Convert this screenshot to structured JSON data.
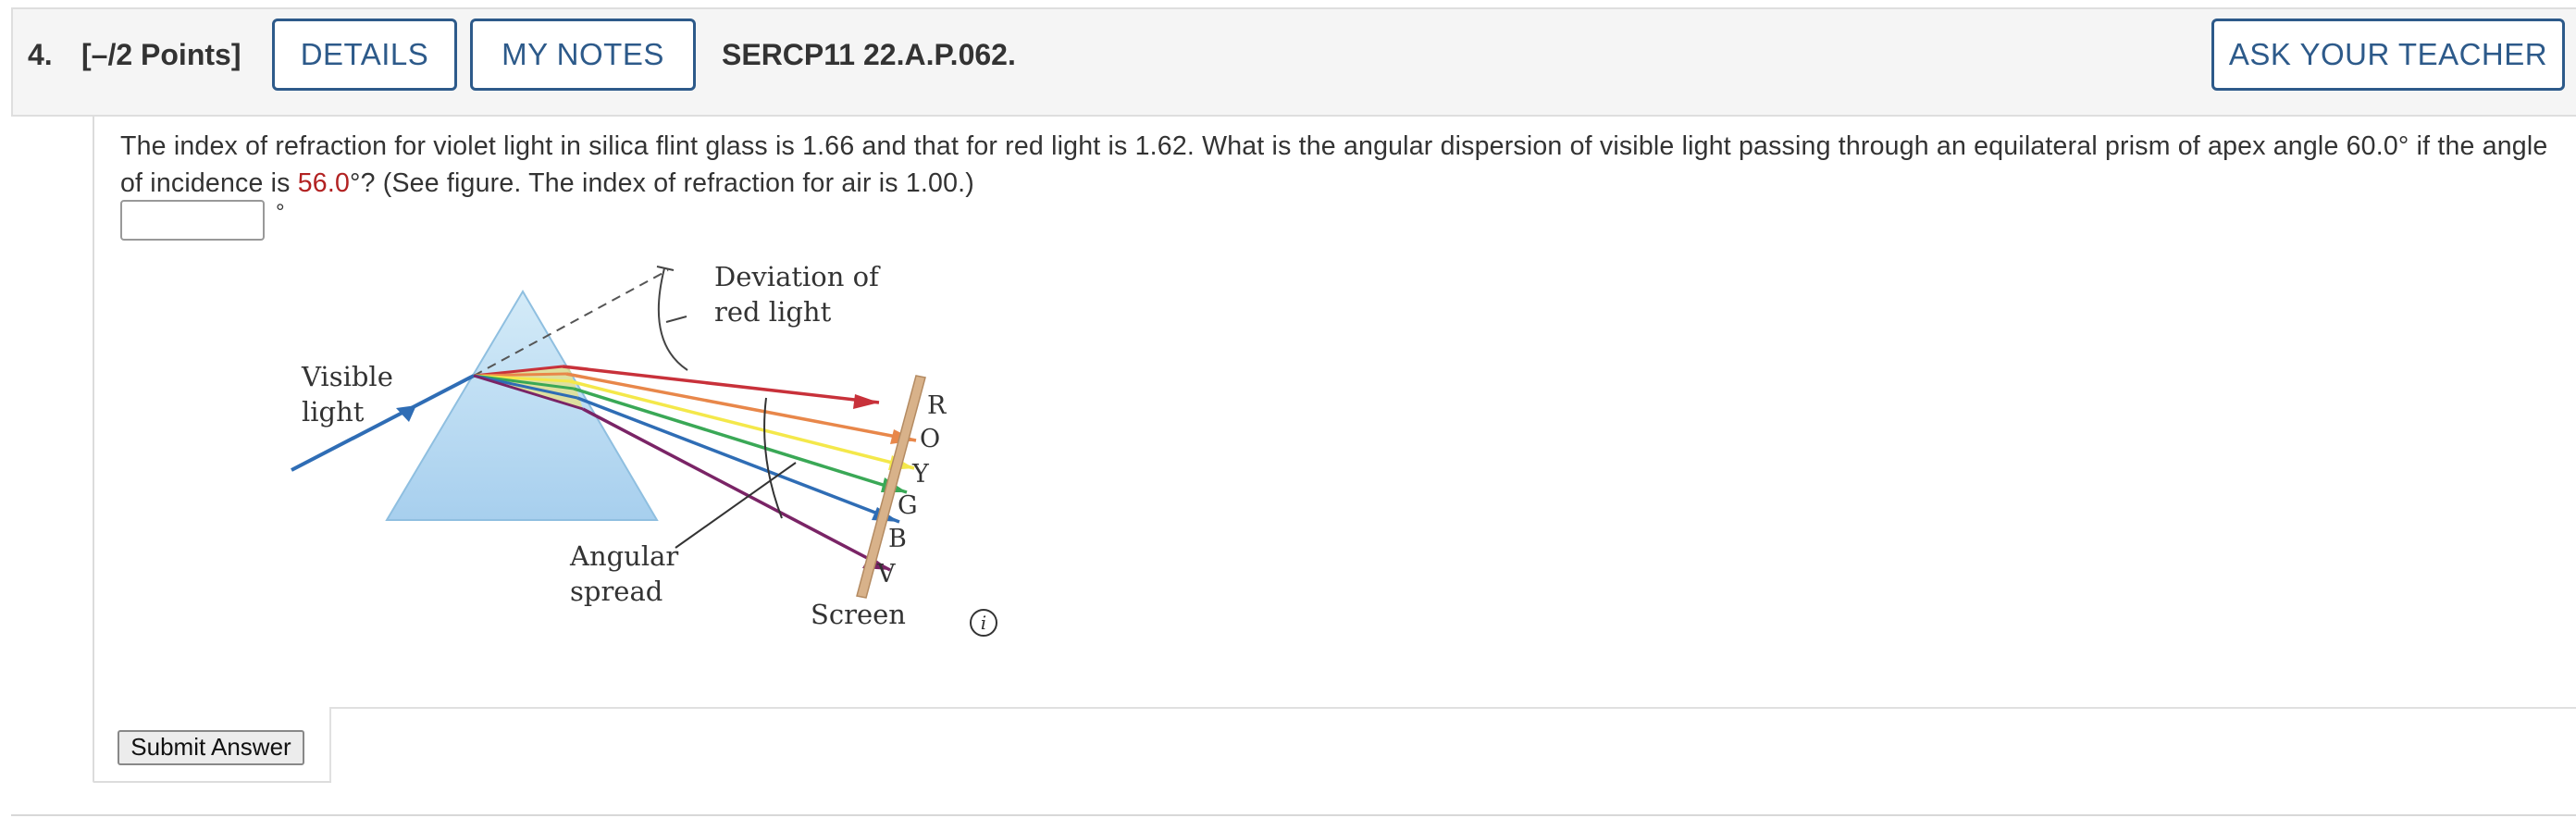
{
  "header": {
    "question_number": "4.",
    "points": "[–/2 Points]",
    "details_label": "DETAILS",
    "notes_label": "MY NOTES",
    "question_code": "SERCP11 22.A.P.062.",
    "ask_teacher_label": "ASK YOUR TEACHER"
  },
  "question": {
    "text_before": "The index of refraction for violet light in silica flint glass is 1.66 and that for red light is 1.62. What is the angular dispersion of visible light passing through an equilateral prism of apex angle 60.0° if the angle of incidence is ",
    "highlight_value": "56.0",
    "text_after": "°? (See figure. The index of refraction for air is 1.00.)",
    "answer_value": "",
    "unit": "°"
  },
  "figure": {
    "deviation_label_line1": "Deviation of",
    "deviation_label_line2": "red light",
    "visible_label_line1": "Visible",
    "visible_label_line2": "light",
    "angular_label_line1": "Angular",
    "angular_label_line2": "spread",
    "screen_label": "Screen",
    "spectrum_letters": [
      "R",
      "O",
      "Y",
      "G",
      "B",
      "V"
    ],
    "colors": {
      "red": "#c8313a",
      "orange": "#e8874a",
      "yellow": "#f4e84a",
      "green": "#3aa856",
      "blue": "#2f6db5",
      "violet": "#7a2466",
      "prism_fill": "#bcdcf2",
      "screen": "#d8b28a"
    }
  },
  "info_icon": "info-icon",
  "submit": {
    "label": "Submit Answer"
  }
}
